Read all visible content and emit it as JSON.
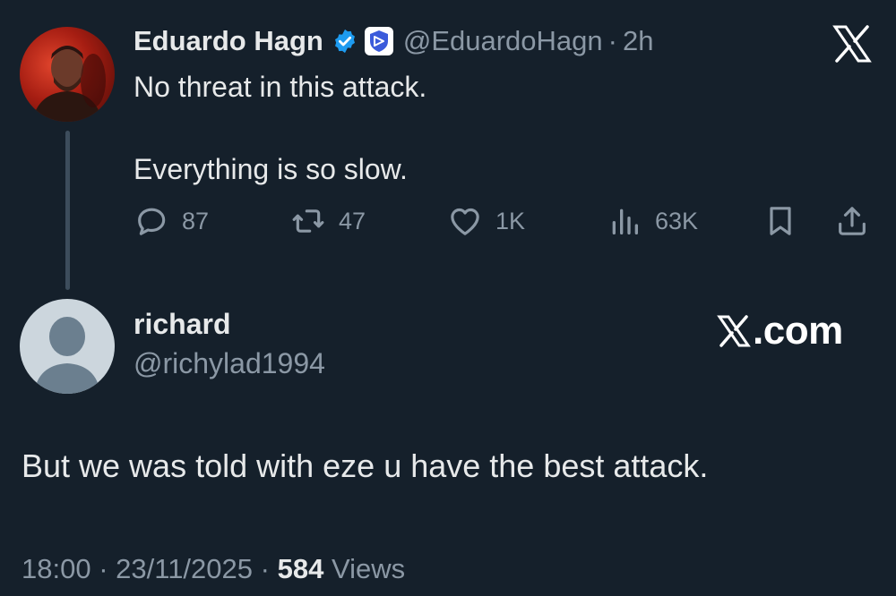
{
  "tweet": {
    "author_name": "Eduardo Hagn",
    "handle": "@EduardoHagn",
    "separator": "·",
    "time": "2h",
    "text": "No threat in this attack.\n\nEverything is so slow.",
    "avatar_icon": "user-avatar-photo",
    "verified_icon": "verified-badge-icon",
    "affiliation_icon": "affiliation-badge-icon",
    "logo_icon": "x-logo-icon",
    "actions": {
      "reply_count": "87",
      "retweet_count": "47",
      "like_count": "1K",
      "views_count": "63K"
    }
  },
  "reply": {
    "name": "richard",
    "handle": "@richylad1994",
    "watermark": ".com",
    "text": "But we was told with eze u have the best attack.",
    "meta": {
      "time": "18:00",
      "separator": "·",
      "date": "23/11/2025",
      "views_count": "584",
      "views_label": "Views"
    }
  },
  "colors": {
    "background": "#15202b",
    "text": "#e7e9ea",
    "muted": "#8b98a5",
    "verified_blue": "#1d9bf0"
  }
}
